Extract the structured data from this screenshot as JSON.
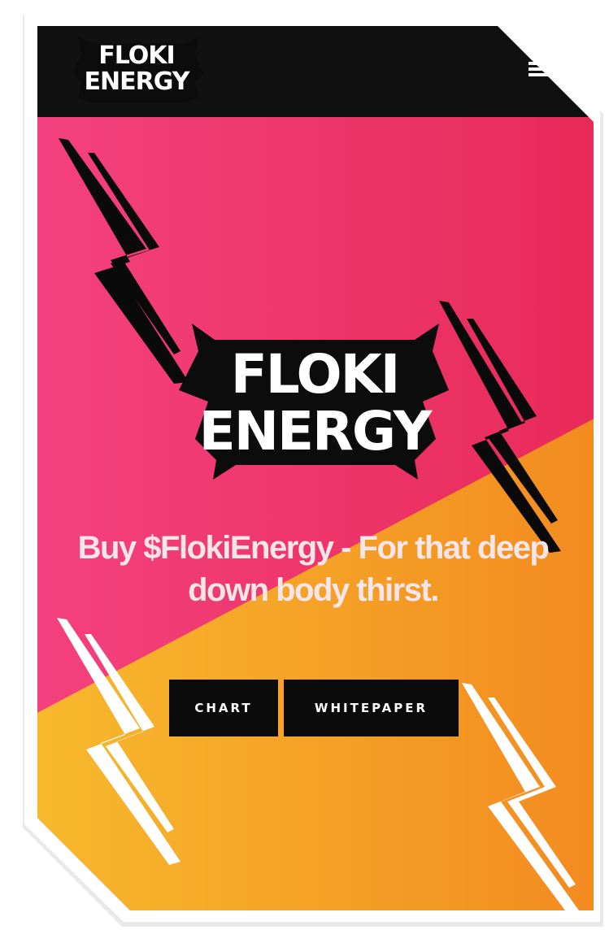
{
  "header": {
    "logo_line1": "FLOKI",
    "logo_line2": "ENERGY",
    "menu_icon": "hamburger-menu-icon"
  },
  "hero": {
    "logo_line1": "FLOKI",
    "logo_line2": "ENERGY",
    "tagline": "Buy $FlokiEnergy - For that deep down body thirst.",
    "buttons": {
      "chart": "CHART",
      "whitepaper": "WHITEPAPER"
    }
  },
  "colors": {
    "header_bg": "#111111",
    "pink_start": "#f4417f",
    "pink_end": "#e82a58",
    "orange_start": "#f7b92d",
    "orange_end": "#f38a20",
    "button_bg": "#0b0b0b"
  }
}
